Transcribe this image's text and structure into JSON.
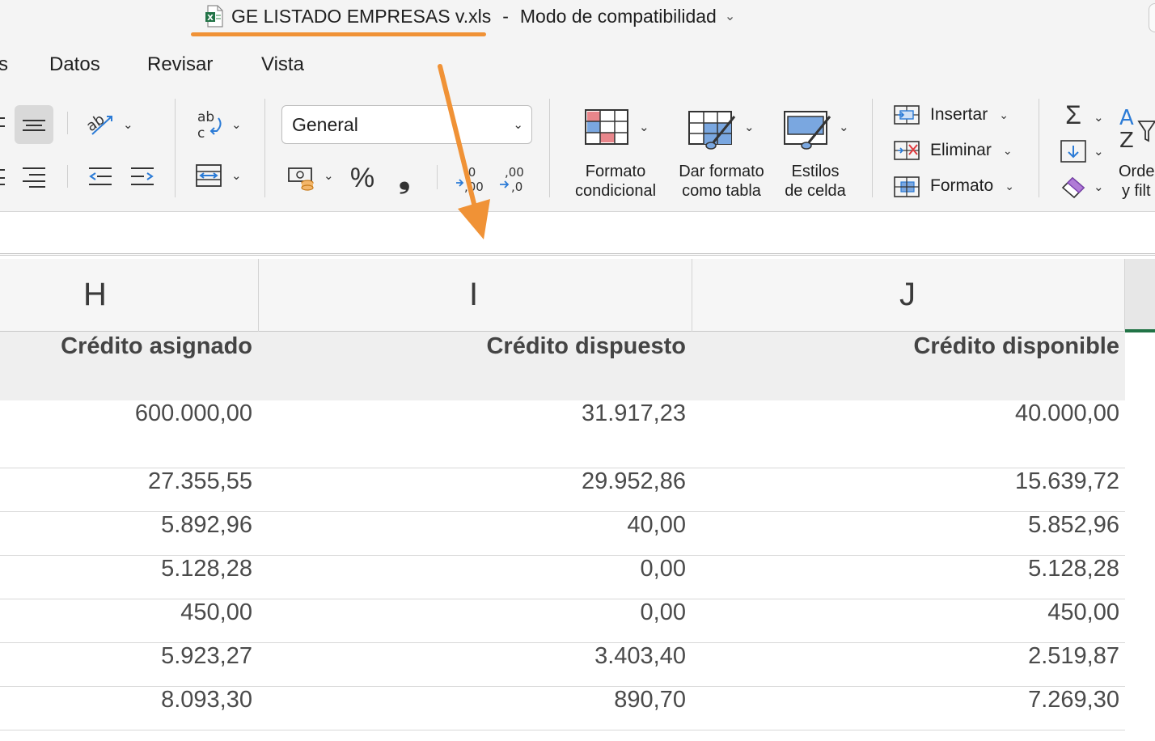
{
  "window": {
    "file_name": "GE LISTADO EMPRESAS v.xls",
    "separator": "-",
    "mode": "Modo de compatibilidad",
    "file_icon": "excel-file-icon"
  },
  "tabs": [
    {
      "label": "s"
    },
    {
      "label": "Datos"
    },
    {
      "label": "Revisar"
    },
    {
      "label": "Vista"
    }
  ],
  "ribbon": {
    "number_format": {
      "value": "General"
    },
    "percent_symbol": "%",
    "comma_symbol": "❟",
    "styles": {
      "conditional_format": {
        "line1": "Formato",
        "line2": "condicional"
      },
      "format_as_table": {
        "line1": "Dar formato",
        "line2": "como tabla"
      },
      "cell_styles": {
        "line1": "Estilos",
        "line2": "de celda"
      }
    },
    "cells": {
      "insert": "Insertar",
      "delete": "Eliminar",
      "format": "Formato"
    },
    "editing": {
      "sort_filter": {
        "line1": "Orde",
        "line2": "y filt"
      }
    }
  },
  "sheet": {
    "columns": [
      "H",
      "I",
      "J"
    ],
    "headers": [
      "Crédito asignado",
      "Crédito dispuesto",
      "Crédito disponible"
    ],
    "rows": [
      [
        "600.000,00",
        "31.917,23",
        "40.000,00"
      ],
      [
        "27.355,55",
        "29.952,86",
        "15.639,72"
      ],
      [
        "5.892,96",
        "40,00",
        "5.852,96"
      ],
      [
        "5.128,28",
        "0,00",
        "5.128,28"
      ],
      [
        "450,00",
        "0,00",
        "450,00"
      ],
      [
        "5.923,27",
        "3.403,40",
        "2.519,87"
      ],
      [
        "8.093,30",
        "890,70",
        "7.269,30"
      ]
    ]
  },
  "colors": {
    "annotation_orange": "#f09236",
    "excel_green": "#217346",
    "conditional_red": "#e8868b",
    "table_blue": "#7aa7e0"
  }
}
